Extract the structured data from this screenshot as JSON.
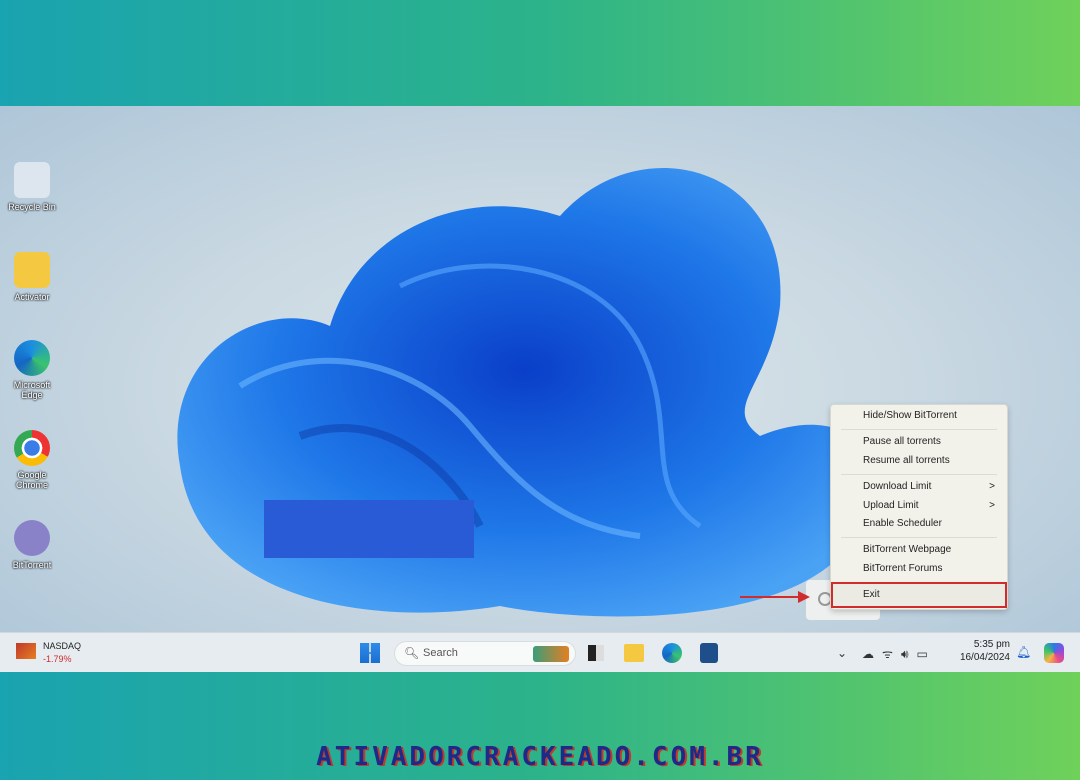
{
  "desktop": {
    "icons": [
      {
        "label": "Recycle Bin",
        "icon": "recycle-bin-icon"
      },
      {
        "label": "Activator",
        "icon": "folder-icon"
      },
      {
        "label": "Microsoft Edge",
        "icon": "edge-icon"
      },
      {
        "label": "Google Chrome",
        "icon": "chrome-icon"
      },
      {
        "label": "BitTorrent",
        "icon": "bittorrent-icon"
      }
    ]
  },
  "context_menu": {
    "items": [
      {
        "label": "Hide/Show BitTorrent"
      },
      {
        "label": "Pause all torrents"
      },
      {
        "label": "Resume all torrents"
      },
      {
        "label": "Download Limit",
        "submenu": ">"
      },
      {
        "label": "Upload Limit",
        "submenu": ">"
      },
      {
        "label": "Enable Scheduler"
      },
      {
        "label": "BitTorrent Webpage"
      },
      {
        "label": "BitTorrent Forums"
      },
      {
        "label": "Exit",
        "highlighted": true
      }
    ]
  },
  "taskbar": {
    "widget_name": "NASDAQ",
    "widget_value": "-1.79%",
    "search_placeholder": "Search",
    "time": "5:35 pm",
    "date": "16/04/2024"
  },
  "watermark": "ATIVADORCRACKEADO.COM.BR",
  "colors": {
    "highlight": "#d22b2b",
    "wallpaper_blue": "#1e6fe0",
    "negative": "#d22b2b"
  }
}
